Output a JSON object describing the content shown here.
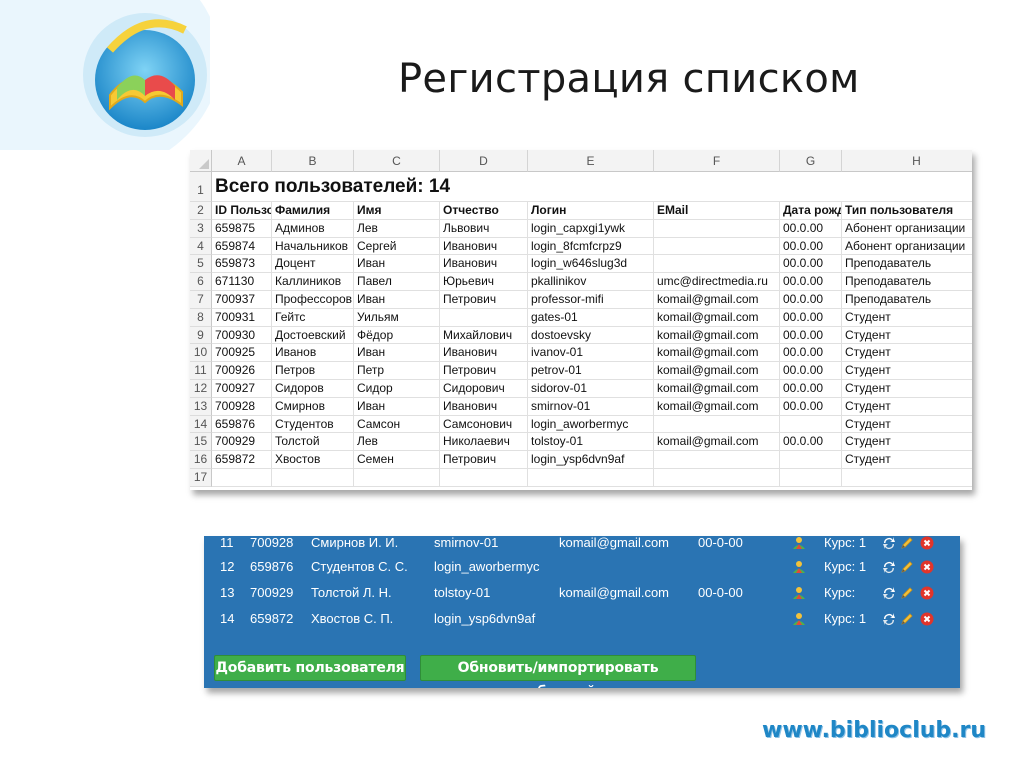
{
  "slide": {
    "title": "Регистрация списком",
    "site": "www.biblioclub.ru"
  },
  "colors": {
    "panel_bg": "#2a74b3",
    "button_green": "#3fae49",
    "site_blue": "#1f87c6"
  },
  "sheet": {
    "columns": [
      "A",
      "B",
      "C",
      "D",
      "E",
      "F",
      "G",
      "H"
    ],
    "row_numbers": [
      "1",
      "2",
      "3",
      "4",
      "5",
      "6",
      "7",
      "8",
      "9",
      "10",
      "11",
      "12",
      "13",
      "14",
      "15",
      "16",
      "17"
    ],
    "summary": "Всего пользователей: 14",
    "headers": [
      "ID Пользователя",
      "Фамилия",
      "Имя",
      "Отчество",
      "Логин",
      "EMail",
      "Дата рождения",
      "Тип пользователя"
    ],
    "rows": [
      [
        "659875",
        "Админов",
        "Лев",
        "Львович",
        "login_capxgi1ywk",
        "",
        "00.0.00",
        "Абонент организации"
      ],
      [
        "659874",
        "Начальников",
        "Сергей",
        "Иванович",
        "login_8fcmfcrpz9",
        "",
        "00.0.00",
        "Абонент организации"
      ],
      [
        "659873",
        "Доцент",
        "Иван",
        "Иванович",
        "login_w646slug3d",
        "",
        "00.0.00",
        "Преподаватель"
      ],
      [
        "671130",
        "Каллиников",
        "Павел",
        "Юрьевич",
        "pkallinikov",
        "umc@directmedia.ru",
        "00.0.00",
        "Преподаватель"
      ],
      [
        "700937",
        "Профессоров",
        "Иван",
        "Петрович",
        "professor-mifi",
        "komail@gmail.com",
        "00.0.00",
        "Преподаватель"
      ],
      [
        "700931",
        "Гейтс",
        "Уильям",
        "",
        "gates-01",
        "komail@gmail.com",
        "00.0.00",
        "Студент"
      ],
      [
        "700930",
        "Достоевский",
        "Фёдор",
        "Михайлович",
        "dostoevsky",
        "komail@gmail.com",
        "00.0.00",
        "Студент"
      ],
      [
        "700925",
        "Иванов",
        "Иван",
        "Иванович",
        "ivanov-01",
        "komail@gmail.com",
        "00.0.00",
        "Студент"
      ],
      [
        "700926",
        "Петров",
        "Петр",
        "Петрович",
        "petrov-01",
        "komail@gmail.com",
        "00.0.00",
        "Студент"
      ],
      [
        "700927",
        "Сидоров",
        "Сидор",
        "Сидорович",
        "sidorov-01",
        "komail@gmail.com",
        "00.0.00",
        "Студент"
      ],
      [
        "700928",
        "Смирнов",
        "Иван",
        "Иванович",
        "smirnov-01",
        "komail@gmail.com",
        "00.0.00",
        "Студент"
      ],
      [
        "659876",
        "Студентов",
        "Самсон",
        "Самсонович",
        "login_aworbermyc",
        "",
        "",
        "Студент"
      ],
      [
        "700929",
        "Толстой",
        "Лев",
        "Николаевич",
        "tolstoy-01",
        "komail@gmail.com",
        "00.0.00",
        "Студент"
      ],
      [
        "659872",
        "Хвостов",
        "Семен",
        "Петрович",
        "login_ysp6dvn9af",
        "",
        "",
        "Студент"
      ]
    ]
  },
  "app": {
    "rows": [
      {
        "num": "11",
        "id": "700928",
        "name": "Смирнов И. И.",
        "login": "smirnov-01",
        "email": "komail@gmail.com",
        "date": "00-0-00",
        "course": "Курс: 1"
      },
      {
        "num": "12",
        "id": "659876",
        "name": "Студентов С. С.",
        "login": "login_aworbermyc",
        "email": "",
        "date": "",
        "course": "Курс: 1"
      },
      {
        "num": "13",
        "id": "700929",
        "name": "Толстой Л. Н.",
        "login": "tolstoy-01",
        "email": "komail@gmail.com",
        "date": "00-0-00",
        "course": "Курс:"
      },
      {
        "num": "14",
        "id": "659872",
        "name": "Хвостов С. П.",
        "login": "login_ysp6dvn9af",
        "email": "",
        "date": "",
        "course": "Курс: 1"
      }
    ],
    "add_user_label": "Добавить пользователя",
    "import_label": "Обновить/импортировать таблицей"
  }
}
